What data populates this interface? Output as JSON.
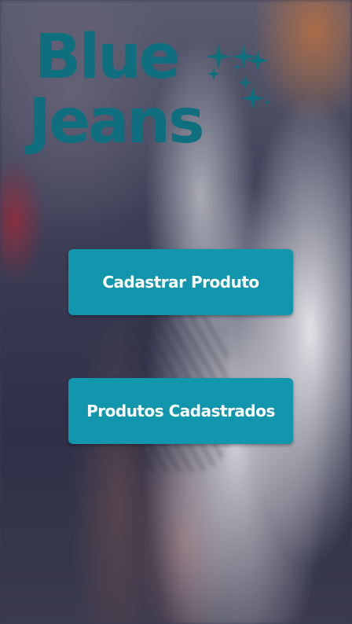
{
  "logo": {
    "line1": "Blue",
    "line2": "Jeans",
    "icon": "sparkles-icon"
  },
  "actions": {
    "register_product": "Cadastrar Produto",
    "registered_products": "Produtos Cadastrados"
  },
  "colors": {
    "brand": "#0f6f7e",
    "button": "#1296ad",
    "button_text": "#ffffff"
  }
}
